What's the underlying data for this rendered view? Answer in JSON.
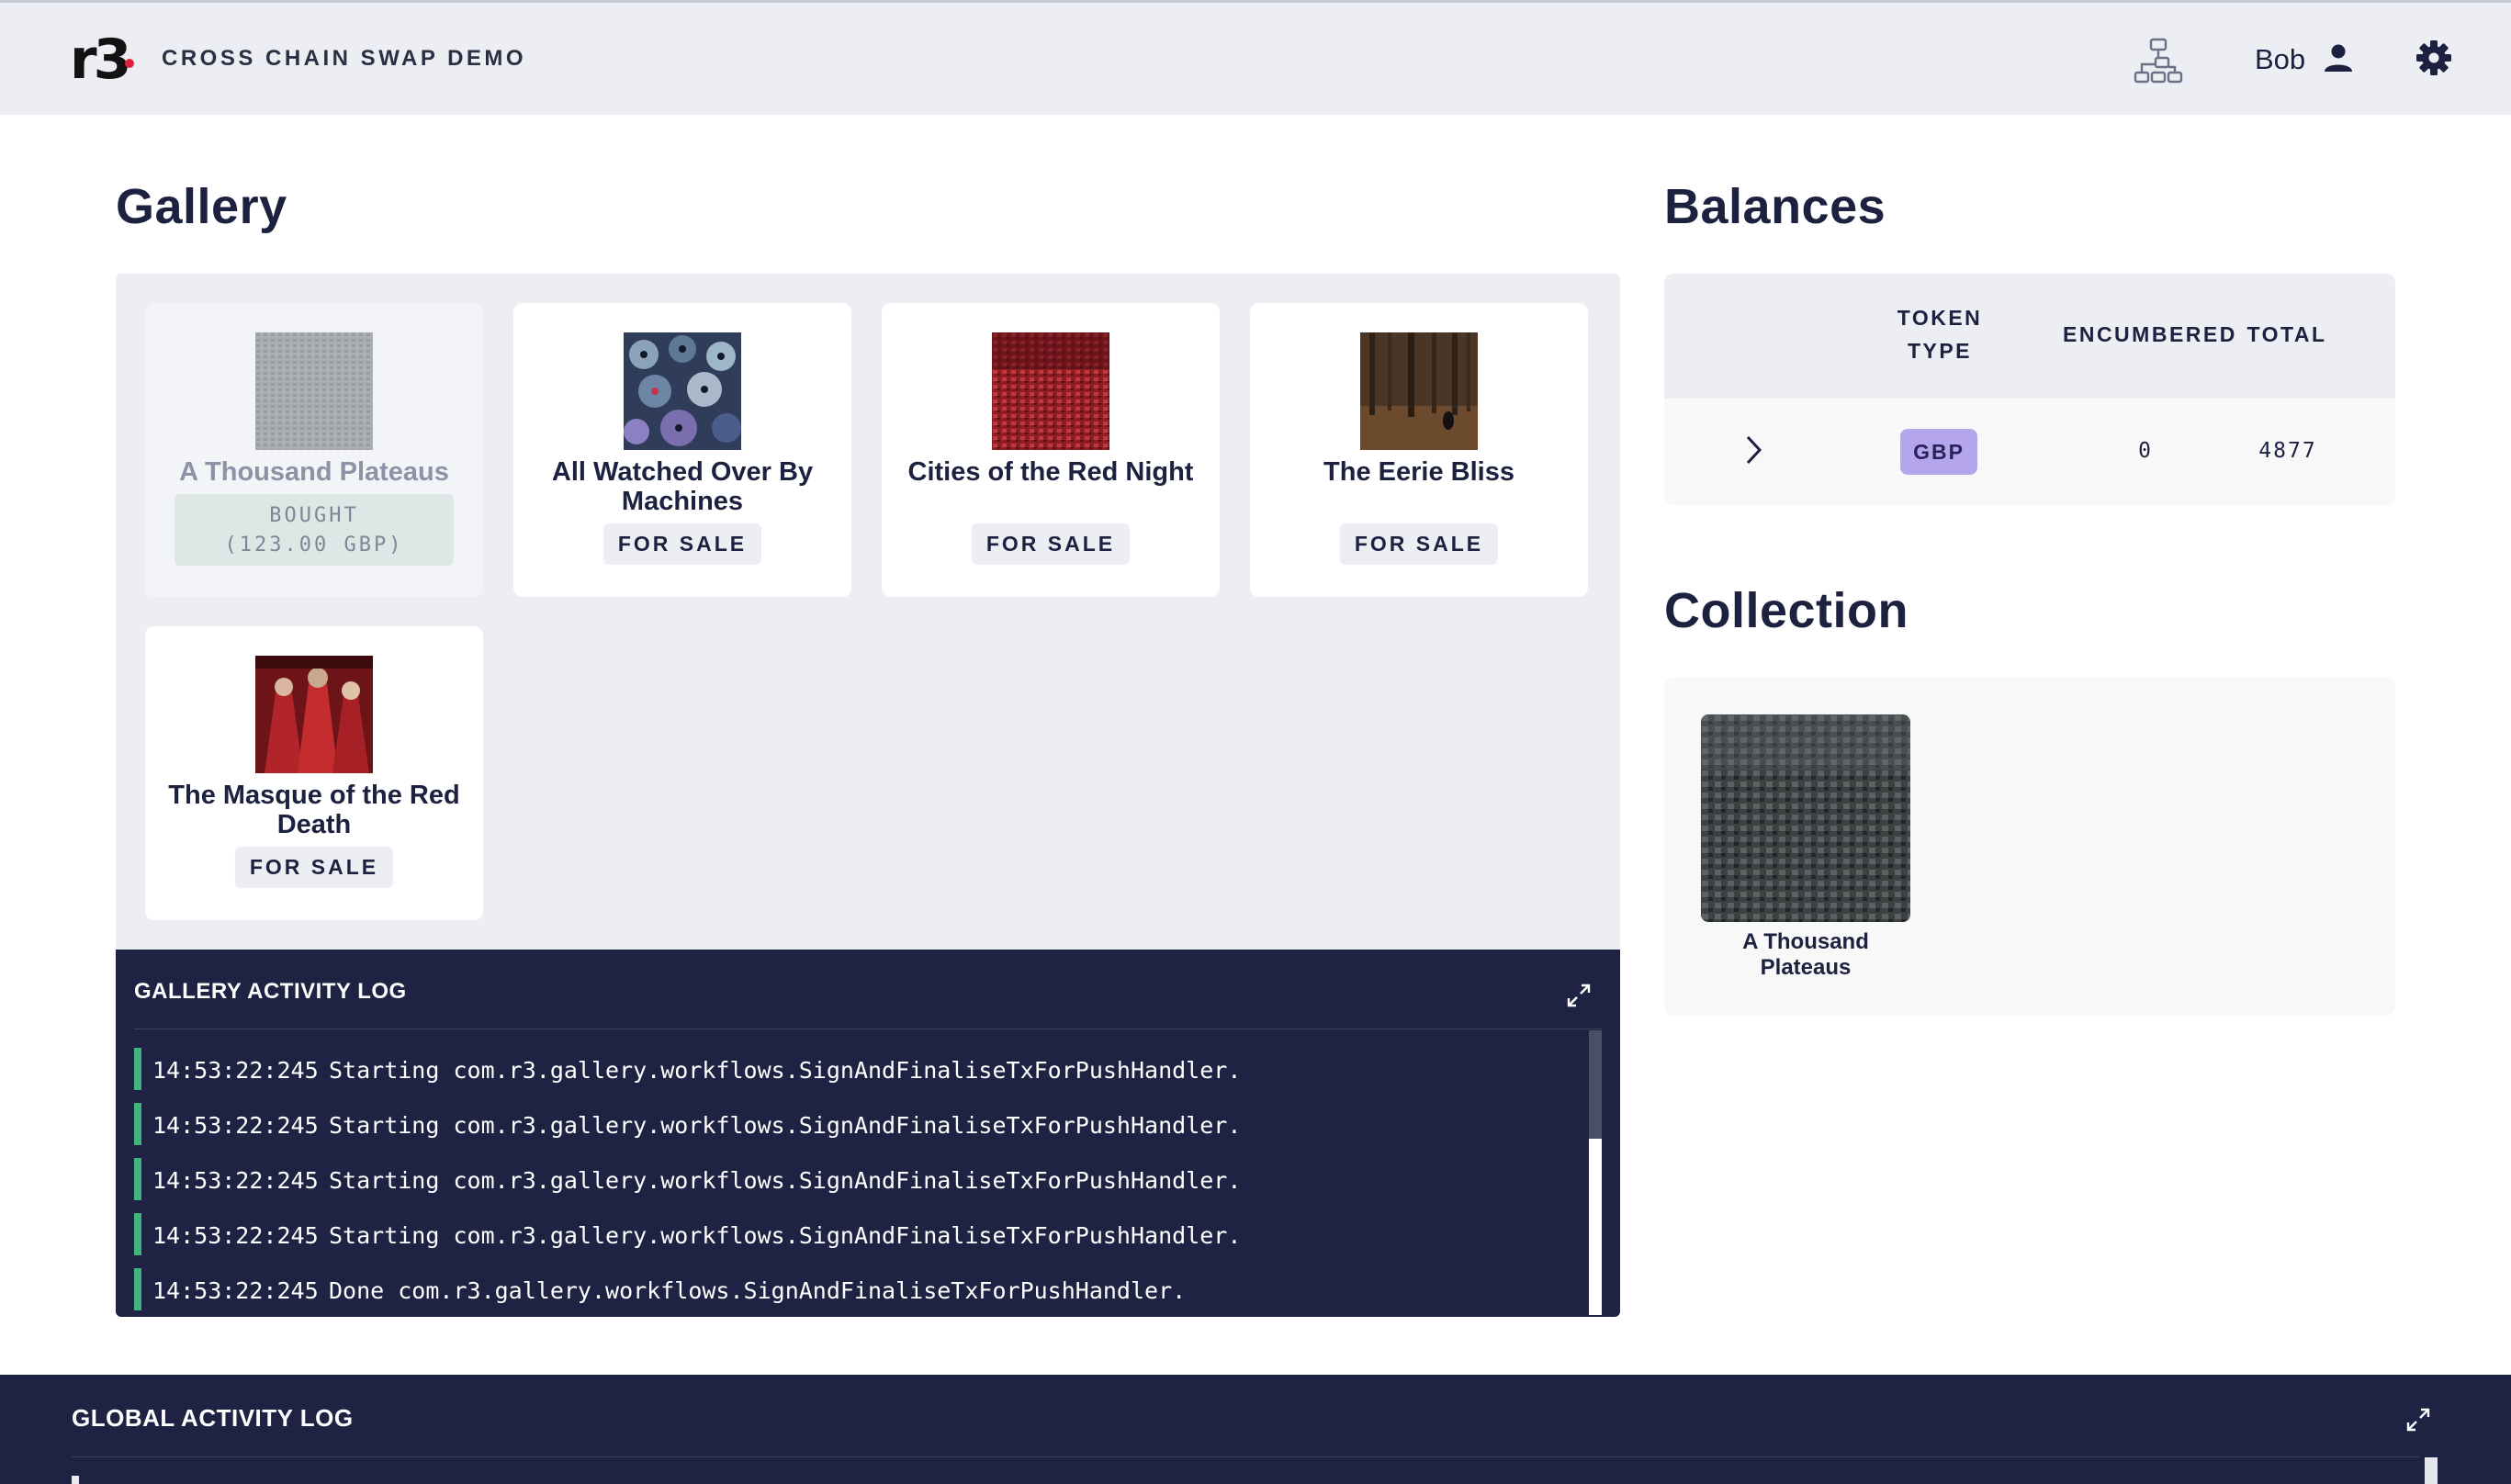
{
  "header": {
    "logo_text": "r3",
    "app_title": "CROSS CHAIN SWAP DEMO",
    "user_name": "Bob",
    "icons": [
      "network-icon",
      "user-icon",
      "gear-icon"
    ]
  },
  "gallery": {
    "heading": "Gallery",
    "cards": [
      {
        "title": "A Thousand Plateaus",
        "status": "bought",
        "bought_label": "BOUGHT",
        "price": "(123.00 GBP)"
      },
      {
        "title": "All Watched Over By Machines",
        "status": "for_sale",
        "badge": "FOR SALE"
      },
      {
        "title": "Cities of the Red Night",
        "status": "for_sale",
        "badge": "FOR SALE"
      },
      {
        "title": "The Eerie Bliss",
        "status": "for_sale",
        "badge": "FOR SALE"
      },
      {
        "title": "The Masque of the Red Death",
        "status": "for_sale",
        "badge": "FOR SALE"
      }
    ]
  },
  "gallery_log": {
    "title": "GALLERY ACTIVITY LOG",
    "entries": [
      {
        "time": "14:53:22:245",
        "message": "Starting com.r3.gallery.workflows.SignAndFinaliseTxForPushHandler."
      },
      {
        "time": "14:53:22:245",
        "message": "Starting com.r3.gallery.workflows.SignAndFinaliseTxForPushHandler."
      },
      {
        "time": "14:53:22:245",
        "message": "Starting com.r3.gallery.workflows.SignAndFinaliseTxForPushHandler."
      },
      {
        "time": "14:53:22:245",
        "message": "Starting com.r3.gallery.workflows.SignAndFinaliseTxForPushHandler."
      },
      {
        "time": "14:53:22:245",
        "message": "Done com.r3.gallery.workflows.SignAndFinaliseTxForPushHandler."
      }
    ]
  },
  "balances": {
    "heading": "Balances",
    "columns": {
      "token_type": "TOKEN TYPE",
      "encumbered": "ENCUMBERED",
      "total": "TOTAL"
    },
    "rows": [
      {
        "token": "GBP",
        "encumbered": "0",
        "total": "4877"
      }
    ]
  },
  "collection": {
    "heading": "Collection",
    "items": [
      {
        "title": "A Thousand Plateaus"
      }
    ]
  },
  "global_log": {
    "title": "GLOBAL ACTIVITY LOG"
  },
  "colors": {
    "accent_navy": "#1e2344",
    "log_green": "#3fb37c",
    "token_purple": "#b5a6ec",
    "brand_red": "#e2233e"
  }
}
